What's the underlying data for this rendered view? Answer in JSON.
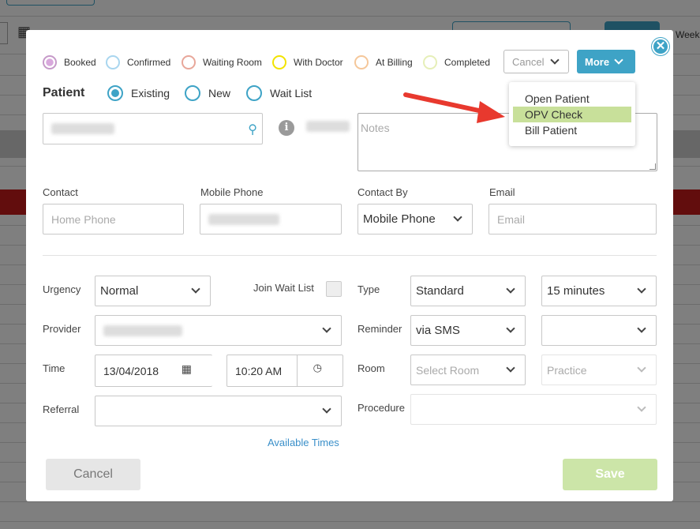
{
  "background": {
    "weekly_label": "Week"
  },
  "statuses": [
    {
      "label": "Booked",
      "color": "#c69ac9"
    },
    {
      "label": "Confirmed",
      "color": "#a9d6ef"
    },
    {
      "label": "Waiting Room",
      "color": "#e8a79a"
    },
    {
      "label": "With Doctor",
      "color": "#f2e300"
    },
    {
      "label": "At Billing",
      "color": "#f5c79a"
    },
    {
      "label": "Completed",
      "color": "#e6efb8"
    }
  ],
  "header": {
    "cancel_select": "Cancel",
    "more_button": "More"
  },
  "more_menu": {
    "items": [
      "Open Patient",
      "OPV Check",
      "Bill Patient"
    ],
    "highlighted": "OPV Check"
  },
  "patient": {
    "title": "Patient",
    "options": [
      "Existing",
      "New",
      "Wait List"
    ],
    "selected": "Existing",
    "notes_placeholder": "Notes"
  },
  "contact": {
    "contact_label": "Contact",
    "home_phone_placeholder": "Home Phone",
    "mobile_label": "Mobile Phone",
    "contact_by_label": "Contact By",
    "contact_by_value": "Mobile Phone",
    "email_label": "Email",
    "email_placeholder": "Email"
  },
  "appointment": {
    "urgency_label": "Urgency",
    "urgency_value": "Normal",
    "join_wait_list_label": "Join Wait List",
    "type_label": "Type",
    "type_value": "Standard",
    "duration_value": "15 minutes",
    "provider_label": "Provider",
    "reminder_label": "Reminder",
    "reminder_value": "via SMS",
    "time_label": "Time",
    "date_value": "13/04/2018",
    "time_value": "10:20 AM",
    "room_label": "Room",
    "room_placeholder": "Select Room",
    "practice_placeholder": "Practice",
    "referral_label": "Referral",
    "procedure_label": "Procedure",
    "available_times_link": "Available Times"
  },
  "footer": {
    "cancel": "Cancel",
    "save": "Save"
  },
  "colors": {
    "accent": "#3ea3c6",
    "save_disabled": "#cce5a8",
    "highlight": "#c8e09a",
    "arrow": "#e8392e"
  }
}
